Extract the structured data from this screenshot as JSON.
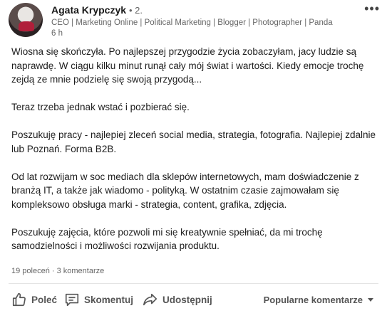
{
  "post": {
    "author": "Agata Krypczyk",
    "degree": "• 2.",
    "headline": "CEO | Marketing Online | Political Marketing | Blogger | Photographer | Panda",
    "time": "6 h",
    "more_icon": "more-dots-icon",
    "paragraphs": [
      "Wiosna się skończyła. Po najlepszej przygodzie życia zobaczyłam, jacy ludzie są naprawdę. W ciągu kilku minut runął cały mój świat i wartości. Kiedy emocje trochę zejdą ze mnie podzielę się swoją przygodą...",
      "Teraz trzeba jednak wstać i pozbierać się.",
      "Poszukuję pracy - najlepiej zleceń social media, strategia, fotografia. Najlepiej zdalnie lub Poznań. Forma B2B.",
      "Od lat rozwijam w soc mediach dla sklepów internetowych, mam doświadczenie z branżą IT, a także jak wiadomo - polityką. W ostatnim czasie zajmowałam się kompleksowo obsługa marki - strategia, content, grafika, zdjęcia.",
      "Poszukuję zajęcia, które pozwoli mi się kreatywnie spełniać, da mi trochę samodzielności i możliwości rozwijania produktu."
    ],
    "social_counts": "19 poleceń · 3 komentarze"
  },
  "actions": {
    "like": "Poleć",
    "comment": "Skomentuj",
    "share": "Udostępnij",
    "sort": "Popularne komentarze"
  },
  "colors": {
    "text": "#1d1d1d",
    "muted": "#666666",
    "action": "#555555"
  }
}
